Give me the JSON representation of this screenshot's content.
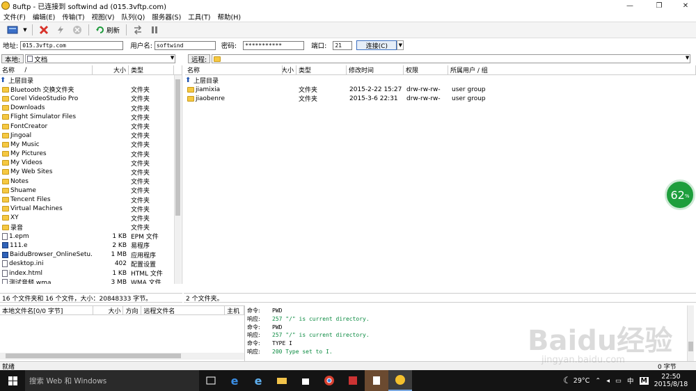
{
  "window": {
    "title": "8uftp - 已连接到 softwind ad (015.3vftp.com)"
  },
  "menu": [
    "文件(F)",
    "编辑(E)",
    "传输(T)",
    "视图(V)",
    "队列(Q)",
    "服务器(S)",
    "工具(T)",
    "帮助(H)"
  ],
  "toolbar": {
    "refresh_label": "刷新"
  },
  "connection": {
    "address_label": "地址:",
    "address": "015.3vftp.com",
    "user_label": "用户名:",
    "user": "softwind",
    "password_label": "密码:",
    "password": "***********",
    "port_label": "端口:",
    "port": "21",
    "connect_label": "连接(C)"
  },
  "local": {
    "label": "本地:",
    "path": "文档",
    "columns": [
      "名称",
      "大小",
      "类型"
    ],
    "up_label": "上层目录",
    "files": [
      {
        "name": "Bluetooth 交换文件夹",
        "size": "",
        "type": "文件夹",
        "icon": "folder"
      },
      {
        "name": "Corel VideoStudio Pro",
        "size": "",
        "type": "文件夹",
        "icon": "folder"
      },
      {
        "name": "Downloads",
        "size": "",
        "type": "文件夹",
        "icon": "folder"
      },
      {
        "name": "Flight Simulator Files",
        "size": "",
        "type": "文件夹",
        "icon": "folder"
      },
      {
        "name": "FontCreator",
        "size": "",
        "type": "文件夹",
        "icon": "folder"
      },
      {
        "name": "Jingoal",
        "size": "",
        "type": "文件夹",
        "icon": "folder"
      },
      {
        "name": "My Music",
        "size": "",
        "type": "文件夹",
        "icon": "music"
      },
      {
        "name": "My Pictures",
        "size": "",
        "type": "文件夹",
        "icon": "pictures"
      },
      {
        "name": "My Videos",
        "size": "",
        "type": "文件夹",
        "icon": "videos"
      },
      {
        "name": "My Web Sites",
        "size": "",
        "type": "文件夹",
        "icon": "web"
      },
      {
        "name": "Notes",
        "size": "",
        "type": "文件夹",
        "icon": "folder"
      },
      {
        "name": "Shuame",
        "size": "",
        "type": "文件夹",
        "icon": "folder"
      },
      {
        "name": "Tencent Files",
        "size": "",
        "type": "文件夹",
        "icon": "folder"
      },
      {
        "name": "Virtual Machines",
        "size": "",
        "type": "文件夹",
        "icon": "folder"
      },
      {
        "name": "XY",
        "size": "",
        "type": "文件夹",
        "icon": "folder"
      },
      {
        "name": "录音",
        "size": "",
        "type": "文件夹",
        "icon": "folder"
      },
      {
        "name": "1.epm",
        "size": "1 KB",
        "type": "EPM 文件",
        "icon": "file"
      },
      {
        "name": "111.e",
        "size": "2 KB",
        "type": "易程序",
        "icon": "app"
      },
      {
        "name": "BaiduBrowser_OnlineSetu...",
        "size": "1 MB",
        "type": "应用程序",
        "icon": "app"
      },
      {
        "name": "desktop.ini",
        "size": "402",
        "type": "配置设置",
        "icon": "file"
      },
      {
        "name": "index.html",
        "size": "1 KB",
        "type": "HTML 文件",
        "icon": "file"
      },
      {
        "name": "测试音频.wma",
        "size": "3 MB",
        "type": "WMA 文件",
        "icon": "file"
      }
    ],
    "status": "16 个文件夹和 16 个文件，大小：20848333 字节。"
  },
  "remote": {
    "label": "远程:",
    "path": "",
    "columns": [
      "名称",
      "大小",
      "类型",
      "修改时间",
      "权限",
      "所属用户 / 组"
    ],
    "up_label": "上层目录",
    "files": [
      {
        "name": "jiamixia",
        "size": "",
        "type": "文件夹",
        "modified": "2015-2-22 15:27",
        "perm": "drw-rw-rw-",
        "owner": "user group"
      },
      {
        "name": "jiaobenre",
        "size": "",
        "type": "文件夹",
        "modified": "2015-3-6 22:31",
        "perm": "drw-rw-rw-",
        "owner": "user group"
      }
    ],
    "status": "2 个文件夹。"
  },
  "queue": {
    "columns": [
      "本地文件名[0/0 字节]",
      "大小",
      "方向",
      "远程文件名",
      "主机"
    ]
  },
  "log": [
    {
      "k": "命令:",
      "v": "PWD",
      "ok": false
    },
    {
      "k": "响应:",
      "v": "257 \"/\" is current directory.",
      "ok": true
    },
    {
      "k": "命令:",
      "v": "PWD",
      "ok": false
    },
    {
      "k": "响应:",
      "v": "257 \"/\" is current directory.",
      "ok": true
    },
    {
      "k": "命令:",
      "v": "TYPE I",
      "ok": false
    },
    {
      "k": "响应:",
      "v": "200 Type set to I.",
      "ok": true
    }
  ],
  "app_status": {
    "left": "就绪",
    "right": "0 字节"
  },
  "badge": {
    "value": "62",
    "unit": "%"
  },
  "watermark": {
    "text": "Baidu经验",
    "sub": "jingyan.baidu.com"
  },
  "taskbar": {
    "search_placeholder": "搜索 Web 和 Windows",
    "temperature": "29°C",
    "ime": "中",
    "time": "22:50",
    "date": "2015/8/18"
  }
}
